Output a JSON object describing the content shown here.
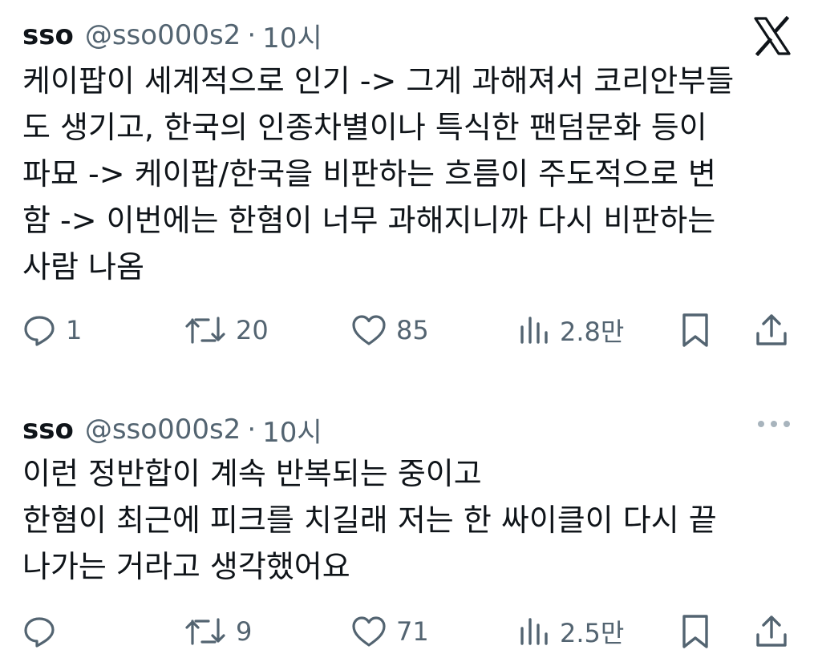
{
  "tweets": [
    {
      "author_name": "sso",
      "handle": "@sso000s2",
      "separator": "·",
      "time": "10시",
      "text": "케이팝이 세계적으로 인기 -> 그게 과해져서 코리안부들\n도 생기고, 한국의 인종차별이나 특식한 팬덤문화 등이\n파묘 -> 케이팝/한국을 비판하는 흐름이 주도적으로 변\n함 -> 이번에는 한혐이 너무 과해지니까 다시 비판하는\n사람 나옴",
      "replies": "1",
      "reposts": "20",
      "likes": "85",
      "views": "2.8만",
      "top_right_icon": "x-logo-icon"
    },
    {
      "author_name": "sso",
      "handle": "@sso000s2",
      "separator": "·",
      "time": "10시",
      "text": "이런 정반합이 계속 반복되는 중이고\n한혐이 최근에 피크를 치길래 저는 한 싸이클이 다시 끝\n나가는 거라고 생각했어요",
      "replies": "",
      "reposts": "9",
      "likes": "71",
      "views": "2.5만",
      "top_right_icon": "more-icon"
    }
  ],
  "colors": {
    "text": "#0f1419",
    "secondary": "#536471",
    "more_dots": "#a8b4bd"
  }
}
